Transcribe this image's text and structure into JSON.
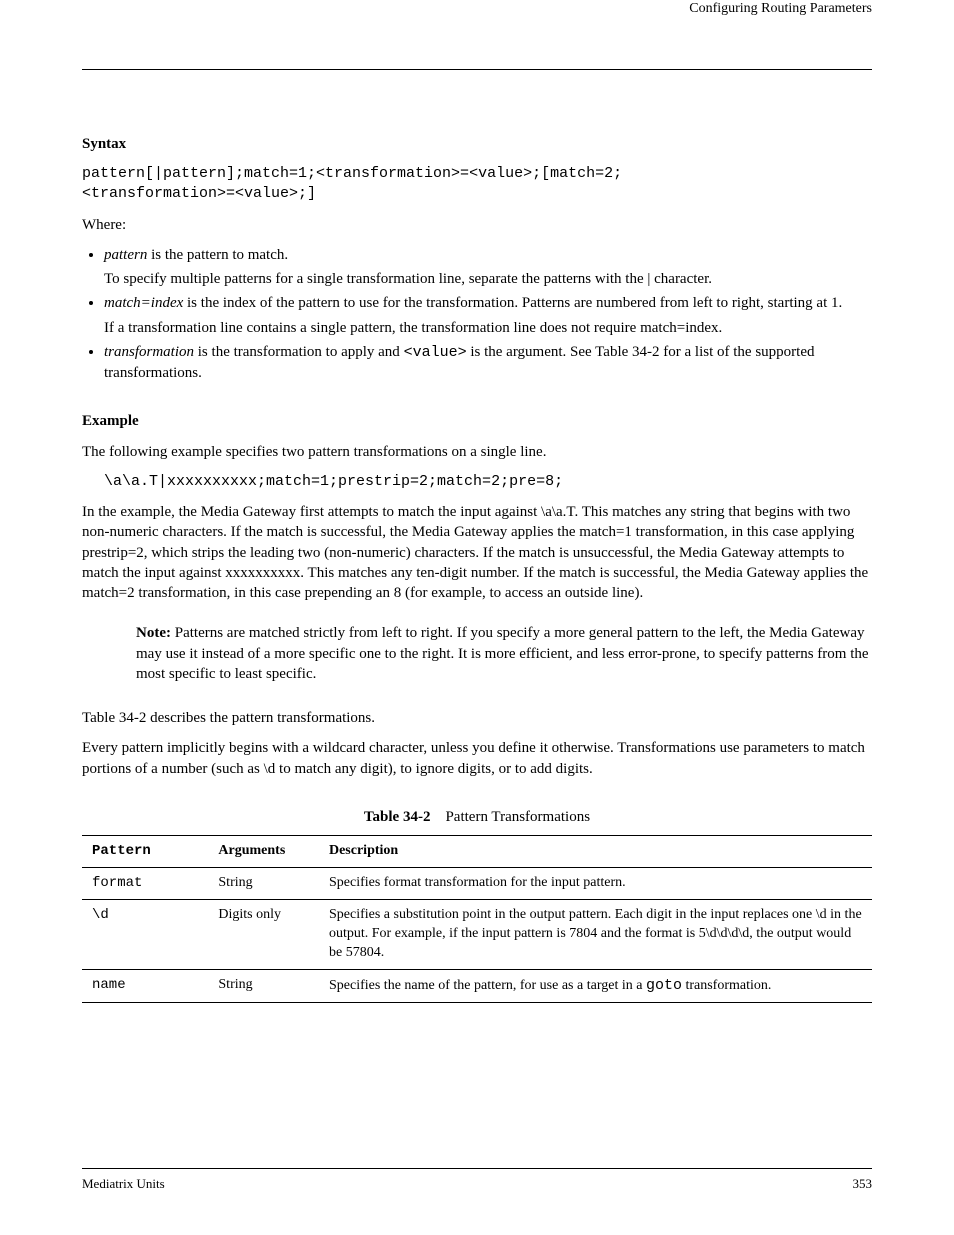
{
  "header": {
    "right": "Configuring Routing Parameters"
  },
  "section": {
    "title": "Syntax"
  },
  "syntax_code": "pattern[|pattern];match=1;<transformation>=<value>;[match=2;\n<transformation>=<value>;]",
  "where_label": "Where:",
  "bullets": [
    {
      "pre": "pattern",
      "post": " is the pattern to match."
    },
    {
      "pre2": "To specify multiple patterns for a single transformation line, separate the patterns with the | character."
    },
    {
      "pre": "match=index",
      "post": " is the index of the pattern to use for the transformation. Patterns are numbered from left to right, starting at 1."
    },
    {
      "pre2": "If a transformation line contains a single pattern, the transformation line does not require match=index."
    },
    {
      "pre": "transformation",
      "post": " is a ",
      "mid_code": "<value>",
      "post2": " is the argument. See Table 34-2 for a list of the supported transformations."
    }
  ],
  "bullet4_prefix": " is the transformation to apply and ",
  "example_label": "Example",
  "example_intro": "The following example specifies two pattern transformations on a single line.",
  "example_code": "\\a\\a.T|xxxxxxxxxx;match=1;prestrip=2;match=2;pre=8;",
  "example_explain": "In the example, the Media Gateway first attempts to match the input against \\a\\a.T. This matches any string that begins with two non-numeric characters. If the match is successful, the Media Gateway applies the match=1 transformation, in this case applying prestrip=2, which strips the leading two (non-numeric) characters. If the match is unsuccessful, the Media Gateway attempts to match the input against xxxxxxxxxx. This matches any ten-digit number. If the match is successful, the Media Gateway applies the match=2 transformation, in this case prepending an 8 (for example, to access an outside line).",
  "note": {
    "label": "Note: ",
    "text": "Patterns are matched strictly from left to right. If you specify a more general pattern to the left, the Media Gateway may use it instead of a more specific one to the right. It is more efficient, and less error-prone, to specify patterns from the most specific to least specific."
  },
  "paragraphs": {
    "after_section": "Table 34-2 describes the pattern transformations.",
    "wildcard": "Every pattern implicitly begins with a wildcard character, unless you define it otherwise. Transformations use parameters to match portions of a number (such as \\d to match any digit), to ignore digits, or to add digits."
  },
  "table": {
    "caption_label": "Table 34-2",
    "caption_text": "Pattern Transformations",
    "headers": [
      "Pattern",
      "Arguments",
      "Description"
    ],
    "rows": [
      {
        "pat": "format",
        "arg": "String",
        "desc": "Specifies format transformation for the input pattern."
      },
      {
        "pat": "\\d",
        "arg": "Digits only",
        "desc": "Specifies a substitution point in the output pattern. Each digit in the input replaces one \\d in the output. For example, if the input pattern is 7804 and the format is 5\\d\\d\\d\\d, the output would be 57804."
      },
      {
        "pat": "name",
        "arg": "String",
        "desc": [
          "Specifies the name of the pattern, for use as a target in a ",
          "goto",
          " transformation."
        ]
      }
    ]
  },
  "footer": {
    "left": "Mediatrix Units",
    "right": "353"
  }
}
